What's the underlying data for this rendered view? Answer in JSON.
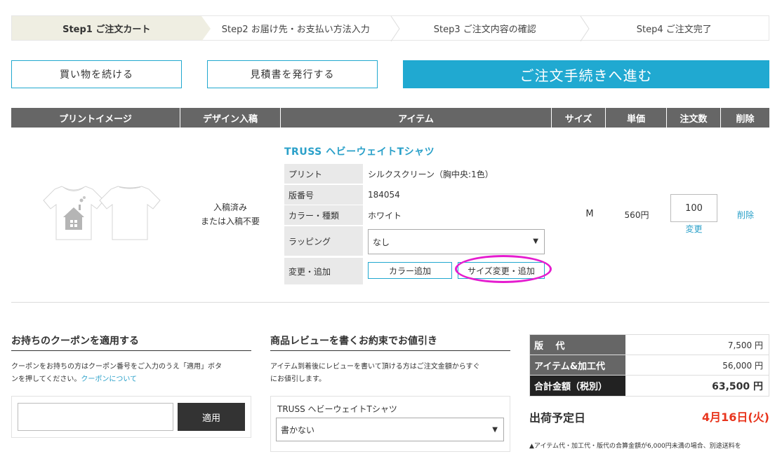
{
  "steps": [
    {
      "label": "Step1 ご注文カート"
    },
    {
      "label": "Step2 お届け先・お支払い方法入力"
    },
    {
      "label": "Step3 ご注文内容の確認"
    },
    {
      "label": "Step4 ご注文完了"
    }
  ],
  "actions": {
    "continue_shopping": "買い物を続ける",
    "issue_quote": "見積書を発行する",
    "proceed": "ご注文手続きへ進む"
  },
  "table": {
    "headers": [
      "プリントイメージ",
      "デザイン入稿",
      "アイテム",
      "サイズ",
      "単価",
      "注文数",
      "削除"
    ]
  },
  "item": {
    "design_status_line1": "入稿済み",
    "design_status_line2": "または入稿不要",
    "title": "TRUSS ヘビーウェイトTシャツ",
    "attributes": [
      {
        "label": "プリント",
        "value": "シルクスクリーン（胸中央:1色）"
      },
      {
        "label": "版番号",
        "value": "184054"
      },
      {
        "label": "カラー・種類",
        "value": "ホワイト"
      }
    ],
    "wrapping_label": "ラッピング",
    "wrapping_value": "なし",
    "modify_label": "変更・追加",
    "add_color": "カラー追加",
    "change_size": "サイズ変更・追加",
    "size": "M",
    "unit_price": "560円",
    "quantity": "100",
    "quantity_change": "変更",
    "delete": "削除"
  },
  "coupon": {
    "title": "お持ちのクーポンを適用する",
    "desc_line1": "クーポンをお持ちの方はクーポン番号をご入力のうえ「適用」ボタ",
    "desc_line2": "ンを押してください。",
    "link": "クーポンについて",
    "apply": "適用"
  },
  "review": {
    "title": "商品レビューを書くお約束でお値引き",
    "desc_line1": "アイテム到着後にレビューを書いて頂ける方はご注文金額からすぐ",
    "desc_line2": "にお値引します。",
    "item_name": "TRUSS ヘビーウェイトTシャツ",
    "select_value": "書かない"
  },
  "summary": {
    "rows": [
      {
        "label": "版　 代",
        "value": "7,500 円"
      },
      {
        "label": "アイテム&加工代",
        "value": "56,000 円"
      },
      {
        "label": "合計金額（税別）",
        "value": "63,500 円"
      }
    ],
    "ship_label": "出荷予定日",
    "ship_date": "4月16日(火)",
    "note": "アイテム代・加工代・版代の合算金額が6,000円未満の場合、別途送料を"
  },
  "colors": {
    "accent": "#20a9d1",
    "step_active": "#efeee2",
    "header_bg": "#666666",
    "highlight": "#e51ccf",
    "ship_date": "#e8351d"
  }
}
